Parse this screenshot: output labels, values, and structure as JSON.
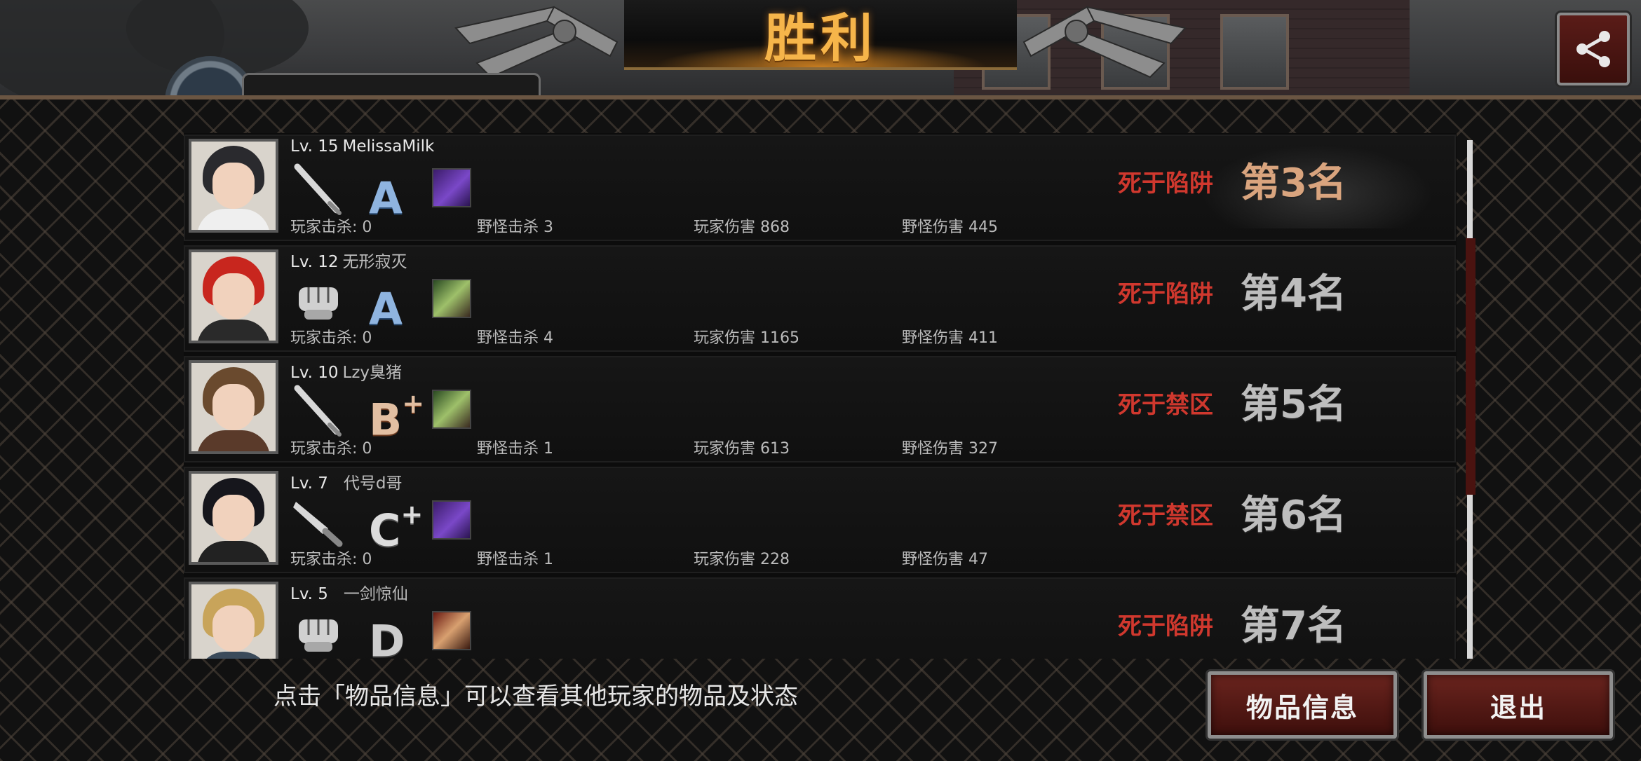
{
  "title": "胜利",
  "share_icon": "share-icon",
  "tip": "点击「物品信息」可以查看其他玩家的物品及状态",
  "buttons": {
    "items": "物品信息",
    "exit": "退出"
  },
  "stat_labels": {
    "player_kills": "玩家击杀",
    "monster_kills": "野怪击杀",
    "player_damage": "玩家伤害",
    "monster_damage": "野怪伤害"
  },
  "rows": [
    {
      "level": "Lv. 15",
      "name": "MelissaMilk",
      "weapon": "bat-icon",
      "grade": "A",
      "grade_plus": "",
      "pet": "purple-creature-icon",
      "player_kills": ": 0",
      "monster_kills": "3",
      "player_damage": "868",
      "monster_damage": "445",
      "death": "死于陷阱",
      "rank": "第3名"
    },
    {
      "level": "Lv. 12",
      "name": "无形寂灭",
      "weapon": "fist-icon",
      "grade": "A",
      "grade_plus": "",
      "pet": "green-girl-icon",
      "player_kills": ": 0",
      "monster_kills": "4",
      "player_damage": "1165",
      "monster_damage": "411",
      "death": "死于陷阱",
      "rank": "第4名"
    },
    {
      "level": "Lv. 10",
      "name": "Lzy臭猪",
      "weapon": "bat-icon",
      "grade": "B",
      "grade_plus": "+",
      "pet": "green-girl-icon",
      "player_kills": ": 0",
      "monster_kills": "1",
      "player_damage": "613",
      "monster_damage": "327",
      "death": "死于禁区",
      "rank": "第5名"
    },
    {
      "level": "Lv. 7",
      "name": "代号d哥",
      "weapon": "knife-icon",
      "grade": "C",
      "grade_plus": "+",
      "pet": "purple-creature-icon",
      "player_kills": ": 0",
      "monster_kills": "1",
      "player_damage": "228",
      "monster_damage": "47",
      "death": "死于禁区",
      "rank": "第6名"
    },
    {
      "level": "Lv. 5",
      "name": "一剑惊仙",
      "weapon": "fist-icon",
      "grade": "D",
      "grade_plus": "",
      "pet": "red-hero-icon",
      "death": "死于陷阱",
      "rank": "第7名"
    }
  ]
}
